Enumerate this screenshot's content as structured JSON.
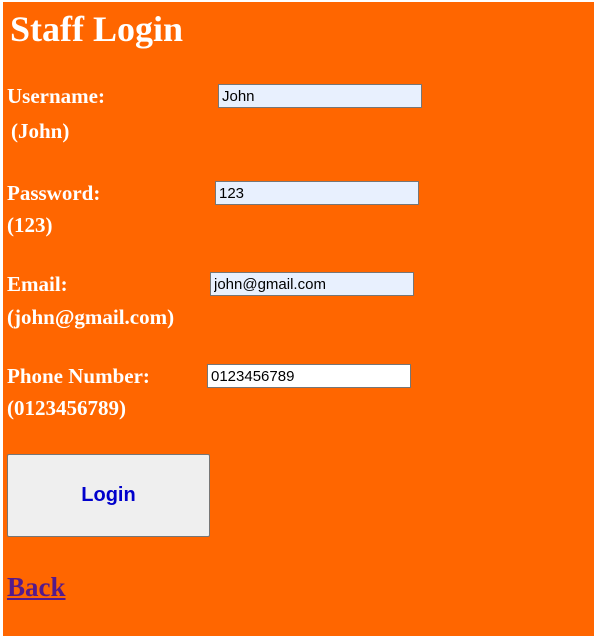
{
  "page": {
    "title": "Staff Login",
    "background_color": "#ff6600"
  },
  "form": {
    "username": {
      "label": "Username:",
      "hint": "(John)",
      "value": "John"
    },
    "password": {
      "label": "Password:",
      "hint": "(123)",
      "value": "123"
    },
    "email": {
      "label": "Email:",
      "hint": "(john@gmail.com)",
      "value": "john@gmail.com"
    },
    "phone": {
      "label": "Phone Number:",
      "hint": "(0123456789)",
      "value": "0123456789"
    },
    "login_label": "Login"
  },
  "back_link": "Back"
}
